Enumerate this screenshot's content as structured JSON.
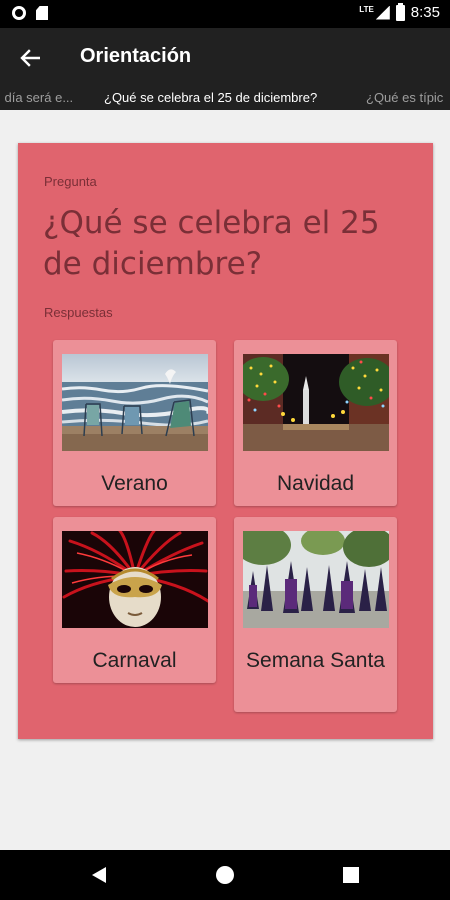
{
  "status_bar": {
    "time": "8:35",
    "network": "LTE"
  },
  "app_bar": {
    "title": "Orientación"
  },
  "ticker": {
    "prev": "l día será e...",
    "current": "¿Qué se celebra el 25 de diciembre?",
    "next": "¿Qué es típic"
  },
  "question": {
    "label": "Pregunta",
    "text": "¿Qué se celebra el 25 de diciembre?",
    "answers_label": "Respuestas"
  },
  "answers": [
    {
      "label": "Verano",
      "image": "beach-chairs-image"
    },
    {
      "label": "Navidad",
      "image": "christmas-lights-image"
    },
    {
      "label": "Carnaval",
      "image": "carnival-mask-image"
    },
    {
      "label": "Semana Santa",
      "image": "procession-image"
    }
  ],
  "colors": {
    "card": "#e0646e",
    "answer_card": "#ec9097",
    "question_text": "#7a2f37",
    "app_bar": "#212121"
  }
}
